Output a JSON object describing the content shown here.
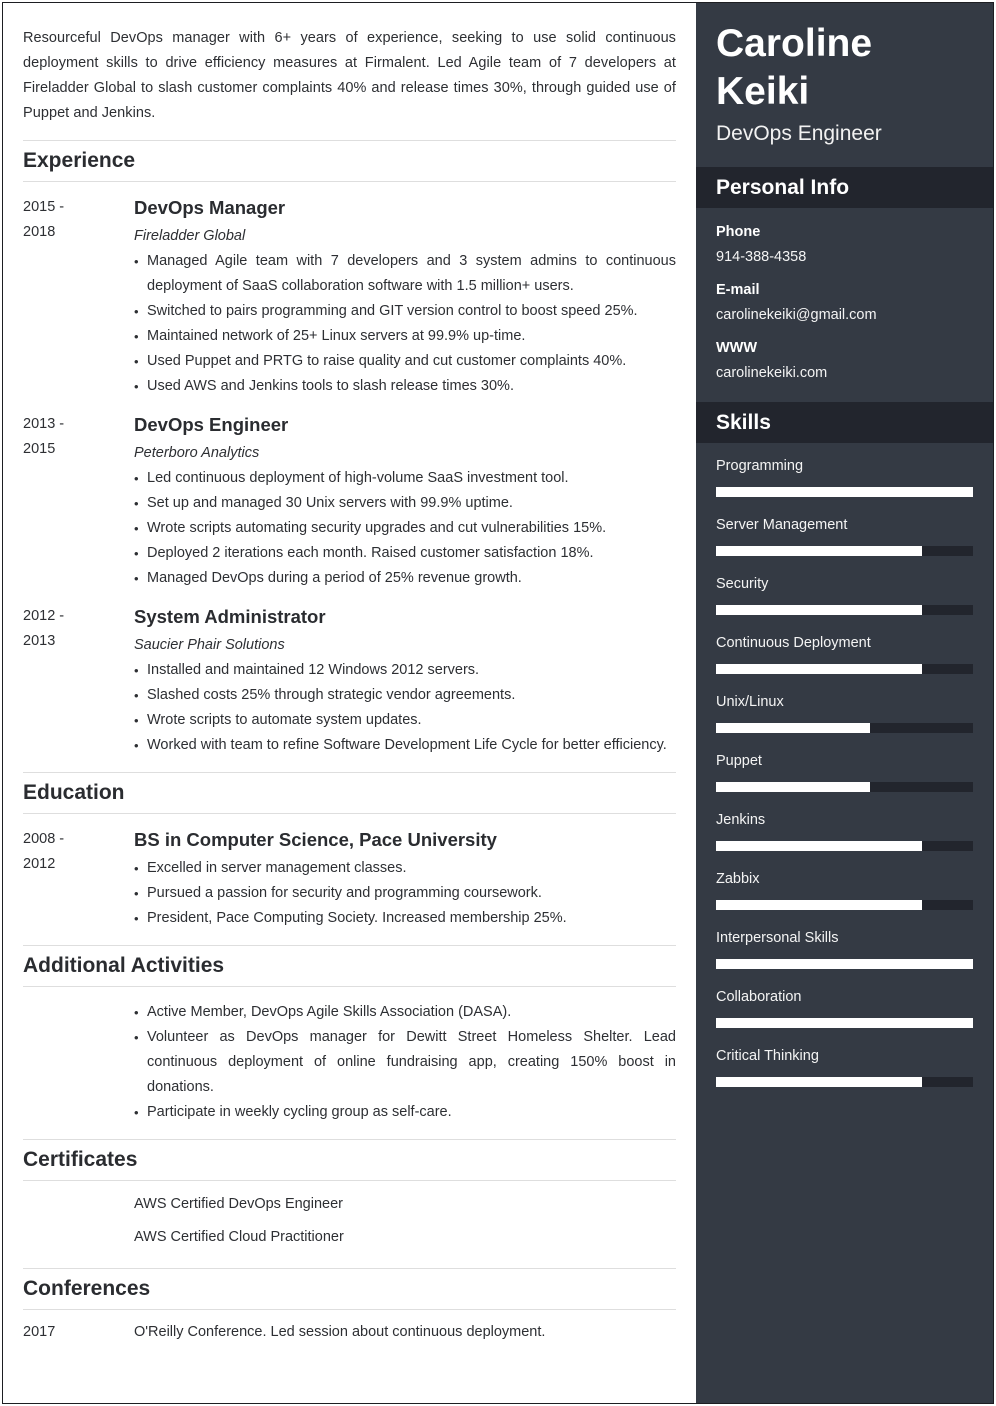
{
  "summary": "Resourceful DevOps manager with 6+ years of experience, seeking to use solid continuous deployment skills to drive efficiency measures at Firmalent. Led Agile team of 7 developers at Fireladder Global to slash customer complaints 40% and release times 30%, through guided use of Puppet and Jenkins.",
  "sections": {
    "experience": "Experience",
    "education": "Education",
    "activities": "Additional Activities",
    "certificates": "Certificates",
    "conferences": "Conferences"
  },
  "experience": [
    {
      "date_start": "2015 -",
      "date_end": "2018",
      "title": "DevOps Manager",
      "company": "Fireladder Global",
      "bullets": [
        "Managed Agile team with 7 developers and 3 system admins to continuous deployment of SaaS collaboration software with 1.5 million+ users.",
        "Switched to pairs programming and GIT version control to boost speed 25%.",
        "Maintained network of 25+ Linux servers at 99.9% up-time.",
        "Used Puppet and PRTG to raise quality and cut customer complaints 40%.",
        "Used AWS and Jenkins tools to slash release times 30%."
      ]
    },
    {
      "date_start": "2013 -",
      "date_end": "2015",
      "title": "DevOps Engineer",
      "company": "Peterboro Analytics",
      "bullets": [
        "Led continuous deployment of high-volume SaaS investment tool.",
        "Set up and managed 30 Unix servers with 99.9% uptime.",
        "Wrote scripts automating security upgrades and cut vulnerabilities 15%.",
        "Deployed 2 iterations each month. Raised customer satisfaction 18%.",
        "Managed DevOps during a period of 25% revenue growth."
      ]
    },
    {
      "date_start": "2012 -",
      "date_end": "2013",
      "title": "System Administrator",
      "company": "Saucier Phair Solutions",
      "bullets": [
        "Installed and maintained 12 Windows 2012 servers.",
        "Slashed costs 25% through strategic vendor agreements.",
        "Wrote scripts to automate system updates.",
        "Worked with team to refine Software Development Life Cycle for better efficiency."
      ]
    }
  ],
  "education": {
    "date_start": "2008 -",
    "date_end": "2012",
    "title": "BS in Computer Science, Pace University",
    "bullets": [
      "Excelled in server management classes.",
      "Pursued a passion for security and programming coursework.",
      "President, Pace Computing Society. Increased membership 25%."
    ]
  },
  "activities": [
    "Active Member, DevOps Agile Skills Association (DASA).",
    "Volunteer as DevOps manager for Dewitt Street Homeless Shelter. Lead continuous deployment of online fundraising app, creating 150% boost in donations.",
    "Participate in weekly cycling group as self-care."
  ],
  "certificates": [
    "AWS Certified DevOps Engineer",
    "AWS Certified Cloud Practitioner"
  ],
  "conferences": [
    {
      "year": "2017",
      "text": "O'Reilly Conference. Led session about continuous deployment."
    }
  ],
  "sidebar": {
    "name_first": "Caroline",
    "name_last": "Keiki",
    "role": "DevOps Engineer",
    "personal_info_heading": "Personal Info",
    "phone_label": "Phone",
    "phone": "914-388-4358",
    "email_label": "E-mail",
    "email": "carolinekeiki@gmail.com",
    "www_label": "WWW",
    "www": "carolinekeiki.com",
    "skills_heading": "Skills",
    "skills": [
      {
        "name": "Programming",
        "level": 1.0
      },
      {
        "name": "Server Management",
        "level": 0.8
      },
      {
        "name": "Security",
        "level": 0.8
      },
      {
        "name": "Continuous Deployment",
        "level": 0.8
      },
      {
        "name": "Unix/Linux",
        "level": 0.6
      },
      {
        "name": "Puppet",
        "level": 0.6
      },
      {
        "name": "Jenkins",
        "level": 0.8
      },
      {
        "name": "Zabbix",
        "level": 0.8
      },
      {
        "name": "Interpersonal Skills",
        "level": 1.0
      },
      {
        "name": "Collaboration",
        "level": 1.0
      },
      {
        "name": "Critical Thinking",
        "level": 0.8
      }
    ]
  },
  "colors": {
    "sidebar_bg": "#343a44",
    "sidebar_heading_bg": "#22252d",
    "skill_fill": "#ffffff"
  }
}
